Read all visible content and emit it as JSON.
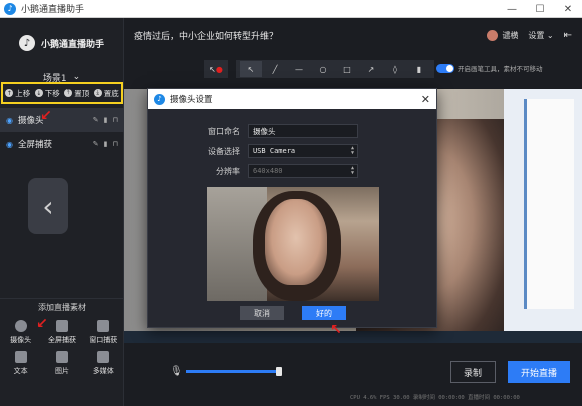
{
  "app": {
    "title": "小鹅通直播助手",
    "brand_name": "小鹅通直播助手"
  },
  "window_controls": {
    "minimize": "—",
    "maximize": "☐",
    "close": "✕"
  },
  "scene": {
    "label": "场景1",
    "chevron": "⌄"
  },
  "layer_toolbar": [
    {
      "label": "上移",
      "icon": "arrow-up-icon"
    },
    {
      "label": "下移",
      "icon": "arrow-down-icon"
    },
    {
      "label": "置顶",
      "icon": "bring-top-icon"
    },
    {
      "label": "置底",
      "icon": "send-bottom-icon"
    }
  ],
  "sources": [
    {
      "name": "摄像头",
      "selected": true
    },
    {
      "name": "全屏捕获",
      "selected": false
    }
  ],
  "add_section": {
    "title": "添加直播素材",
    "items": [
      {
        "label": "摄像头",
        "icon": "camera-icon"
      },
      {
        "label": "全屏捕获",
        "icon": "monitor-icon"
      },
      {
        "label": "窗口捕获",
        "icon": "window-icon"
      },
      {
        "label": "文本",
        "icon": "text-icon"
      },
      {
        "label": "图片",
        "icon": "image-icon"
      },
      {
        "label": "多媒体",
        "icon": "film-icon"
      }
    ]
  },
  "header": {
    "headline": "疫情过后，中小企业如何转型升维？",
    "username": "谴横",
    "settings_label": "设置",
    "settings_chevron": "⌄"
  },
  "tools": {
    "pen_toggle_label": "开启画笔工具，素材不可移动"
  },
  "dialog": {
    "title": "摄像头设置",
    "fields": [
      {
        "label": "窗口命名",
        "value": "摄像头"
      },
      {
        "label": "设备选择",
        "value": "USB Camera"
      },
      {
        "label": "分辨率",
        "value": "640x480"
      }
    ],
    "cancel_label": "取消",
    "ok_label": "好的"
  },
  "bottom": {
    "volume_level": 0.97,
    "record_label": "录制",
    "live_label": "开始直播",
    "status_text": "CPU 4.6%  FPS 30.00  录制时间 00:00:00  直播时间 00:00:00"
  },
  "colors": {
    "accent": "#2d7cf6",
    "highlight_box": "#f5d020",
    "arrow": "#e02020"
  }
}
